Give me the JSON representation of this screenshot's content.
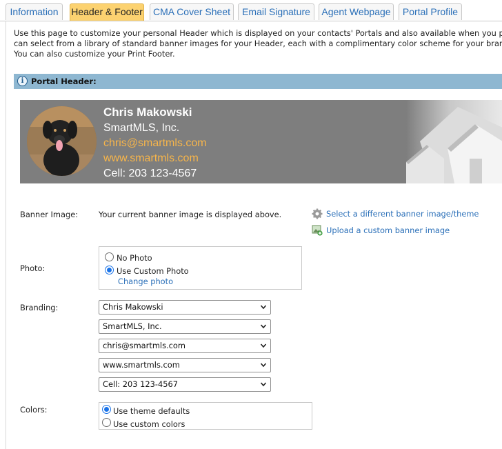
{
  "tabs": [
    {
      "label": "Information",
      "active": false
    },
    {
      "label": "Header & Footer",
      "active": true
    },
    {
      "label": "CMA Cover Sheet",
      "active": false
    },
    {
      "label": "Email Signature",
      "active": false
    },
    {
      "label": "Agent Webpage",
      "active": false
    },
    {
      "label": "Portal Profile",
      "active": false
    }
  ],
  "intro": {
    "line1": "Use this page to customize your personal Header which is displayed on your contacts' Portals and also available when you print",
    "line2": "can select from a library of standard banner images for your Header, each with a complimentary color scheme for your branding",
    "line3": "You can also customize your Print Footer."
  },
  "section": {
    "title": "Portal Header:"
  },
  "banner": {
    "name": "Chris Makowski",
    "company": "SmartMLS, Inc.",
    "email": "chris@smartmls.com",
    "website": "www.smartmls.com",
    "cell": "Cell: 203 123-4567",
    "accent_color": "#f7b54a"
  },
  "banner_image": {
    "label": "Banner Image:",
    "status": "Your current banner image is displayed above.",
    "select_link": "Select a different banner image/theme",
    "upload_link": "Upload a custom banner image"
  },
  "photo": {
    "label": "Photo:",
    "option_none": "No Photo",
    "option_custom": "Use Custom Photo",
    "selected": "Use Custom Photo",
    "change_link": "Change photo"
  },
  "branding": {
    "label": "Branding:",
    "fields": [
      "Chris Makowski",
      "SmartMLS, Inc.",
      "chris@smartmls.com",
      "www.smartmls.com",
      "Cell: 203 123-4567"
    ]
  },
  "colors": {
    "label": "Colors:",
    "option_defaults": "Use theme defaults",
    "option_custom": "Use custom colors",
    "selected": "Use theme defaults"
  }
}
